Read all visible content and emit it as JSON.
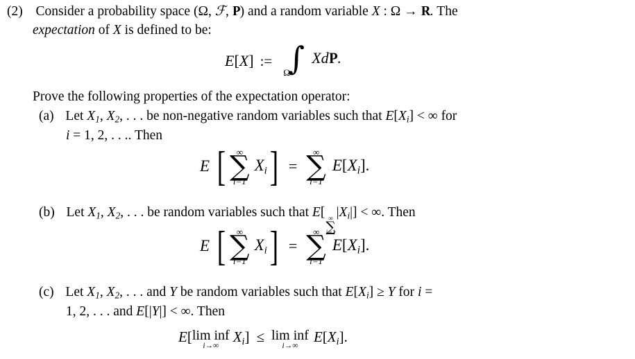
{
  "document": {
    "type": "mathematical-exercise",
    "problem_number": "(2)",
    "background_color": "#ffffff",
    "text_color": "#000000"
  },
  "intro": {
    "line1_a": "Consider a probability space (",
    "omega": "Ω",
    "comma1": ", ",
    "script_f": "ℱ",
    "comma2": ", ",
    "blackboard_p": "P",
    "line1_b": ") and a random variable ",
    "var_x": "X",
    "colon": " : ",
    "omega2": "Ω",
    "arrow": " → ",
    "blackboard_r": "R",
    "line1_c": ". The",
    "line2_italic": "expectation",
    "line2_a": " of ",
    "line2_x": "X",
    "line2_b": " is defined to be:"
  },
  "display_integral": {
    "lhs_E": "E",
    "lhs_bracket_open": "[",
    "lhs_x": "X",
    "lhs_bracket_close": "]",
    "assign": ":=",
    "integral_glyph": "∫",
    "integral_lower": "Ω",
    "integrand_x": "X",
    "integrand_d": "d",
    "integrand_P": "P",
    "period": "."
  },
  "prompt": {
    "text": "Prove the following properties of the expectation operator:"
  },
  "parts": [
    {
      "label": "(a)",
      "line1": {
        "a": "Let ",
        "x1": "X",
        "sub1": "1",
        "sep1": ", ",
        "x2": "X",
        "sub2": "2",
        "ellipsis": ", . . .",
        "b": " be non-negative random variables such that ",
        "cond_E": "E",
        "cond_open": "[",
        "cond_x": "X",
        "cond_sub": "i",
        "cond_close": "]",
        "cond_lt": " < ",
        "cond_inf": "∞",
        "c": " for"
      },
      "line2": {
        "i": "i",
        "eq": " = ",
        "vals": "1, 2, . . ..",
        "then": " Then"
      }
    },
    {
      "label": "(b)",
      "line1": {
        "a": "Let ",
        "x1": "X",
        "sub1": "1",
        "sep1": ", ",
        "x2": "X",
        "sub2": "2",
        "ellipsis": ", . . .",
        "b": " be random variables such that ",
        "cond_E": "E",
        "cond_open": "[",
        "sum_glyph": "∑",
        "sum_upper": "∞",
        "sum_lower": "i=1",
        "abs_open": "|",
        "cond_x": "X",
        "cond_sub": "i",
        "abs_close": "|",
        "cond_close": "]",
        "cond_lt": " < ",
        "cond_inf": "∞",
        "c": ". Then"
      }
    },
    {
      "label": "(c)",
      "line1": {
        "a": "Let ",
        "x1": "X",
        "sub1": "1",
        "sep1": ", ",
        "x2": "X",
        "sub2": "2",
        "ellipsis": ", . . .",
        "b": " and ",
        "var_y": "Y",
        "b2": " be random variables such that ",
        "cond_E": "E",
        "cond_open": "[",
        "cond_x": "X",
        "cond_sub": "i",
        "cond_close": "]",
        "cond_ge": " ≥ ",
        "cond_y": "Y",
        "c": " for ",
        "idx_i": "i",
        "idx_eq": " ="
      },
      "line2": {
        "vals": "1, 2, . . .",
        "and": " and ",
        "E": "E",
        "open": "[",
        "abs_open": "|",
        "y": "Y",
        "abs_close": "|",
        "close": "]",
        "lt": " < ",
        "inf": "∞",
        "then": ". Then"
      }
    }
  ],
  "display_sum_a": {
    "lhs_E": "E",
    "bracket_open": "[",
    "sum_upper": "∞",
    "sum_glyph": "∑",
    "sum_lower": "i=1",
    "arg_x": "X",
    "arg_sub": "i",
    "bracket_close": "]",
    "equals": "=",
    "rhs_sum_upper": "∞",
    "rhs_sum_glyph": "∑",
    "rhs_sum_lower": "i=1",
    "rhs_E": "E",
    "rhs_open": "[",
    "rhs_x": "X",
    "rhs_sub": "i",
    "rhs_close": "]",
    "period": "."
  },
  "display_sum_b": {
    "lhs_E": "E",
    "bracket_open": "[",
    "sum_upper": "∞",
    "sum_glyph": "∑",
    "sum_lower": "i=1",
    "arg_x": "X",
    "arg_sub": "i",
    "bracket_close": "]",
    "equals": "=",
    "rhs_sum_upper": "∞",
    "rhs_sum_glyph": "∑",
    "rhs_sum_lower": "i=1",
    "rhs_E": "E",
    "rhs_open": "[",
    "rhs_x": "X",
    "rhs_sub": "i",
    "rhs_close": "]",
    "period": "."
  },
  "display_liminf": {
    "lhs_E": "E",
    "open": "[",
    "liminf": "lim inf",
    "liminf_sub": "i→∞",
    "x": "X",
    "x_sub": "i",
    "close": "]",
    "le": "≤",
    "rhs_liminf": "lim inf",
    "rhs_liminf_sub": "i→∞",
    "rhs_E": "E",
    "rhs_open": "[",
    "rhs_x": "X",
    "rhs_sub": "i",
    "rhs_close": "]",
    "period": "."
  }
}
